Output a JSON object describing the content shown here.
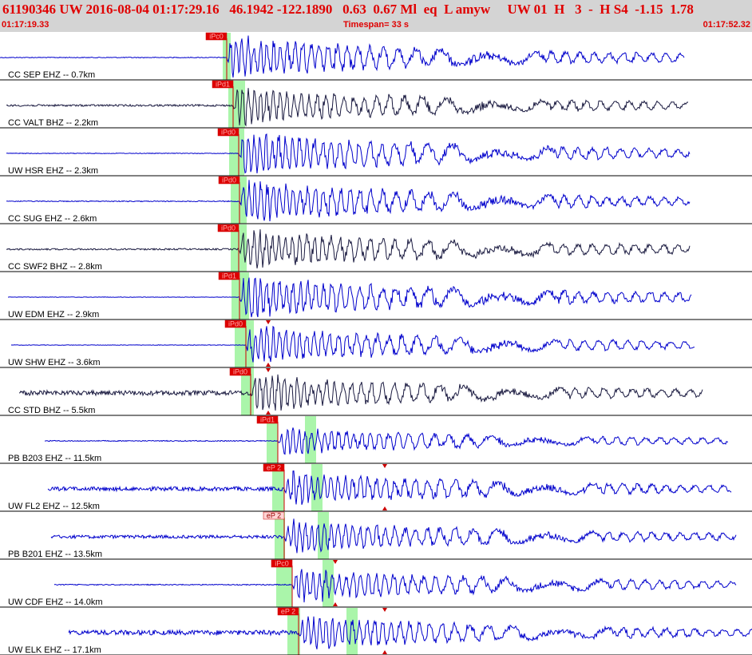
{
  "header": {
    "title": "61190346 UW 2016-08-04 01:17:29.16   46.1942 -122.1890   0.63  0.67 Ml  eq  L amyw     UW 01  H   3  -  H S4  -1.15  1.78",
    "start_time": "01:17:19.33",
    "timespan": "Timespan=  33 s",
    "end_time": "01:17:52.32"
  },
  "colors": {
    "trace_blue": "#0000cc",
    "trace_dark": "#1a1a40",
    "pick_red": "#cc0000",
    "window_green": "#aaf5aa",
    "text_red": "#e00000"
  },
  "traces": [
    {
      "label": "CC SEP EHZ -- 0.7km",
      "pick": "iPc0",
      "pick_style": "red",
      "color": "blue",
      "start": 0,
      "onset": 284,
      "end": 857,
      "amp": 27,
      "noise": 0.5,
      "green": [
        279,
        289
      ]
    },
    {
      "label": "CC VALT BHZ -- 2.2km",
      "pick": "iPd1",
      "pick_style": "red",
      "color": "dark",
      "start": 8,
      "onset": 292,
      "end": 862,
      "amp": 24,
      "noise": 1.2,
      "green": [
        286,
        307
      ]
    },
    {
      "label": "UW HSR EHZ -- 2.3km",
      "pick": "iPd0",
      "pick_style": "red",
      "color": "blue",
      "start": 8,
      "onset": 299,
      "end": 864,
      "amp": 28,
      "noise": 0.4,
      "green": [
        287,
        306
      ]
    },
    {
      "label": "CC SUG EHZ -- 2.6km",
      "pick": "iPd0",
      "pick_style": "red",
      "color": "blue",
      "start": 8,
      "onset": 300,
      "end": 864,
      "amp": 27,
      "noise": 0.6,
      "green": [
        289,
        309
      ]
    },
    {
      "label": "CC SWF2 BHZ -- 2.8km",
      "pick": "iPd0",
      "pick_style": "red",
      "color": "dark",
      "start": 8,
      "onset": 299,
      "end": 864,
      "amp": 26,
      "noise": 1.0,
      "green": [
        289,
        309
      ]
    },
    {
      "label": "UW EDM EHZ -- 2.9km",
      "pick": "iPd1",
      "pick_style": "red",
      "color": "blue",
      "start": 10,
      "onset": 300,
      "end": 866,
      "amp": 28,
      "noise": 0.3,
      "green": [
        290,
        312
      ]
    },
    {
      "label": "UW SHW EHZ -- 3.6km",
      "pick": "iPd0",
      "pick_style": "red",
      "color": "blue",
      "start": 14,
      "onset": 308,
      "end": 870,
      "amp": 24,
      "noise": 0.3,
      "green": [
        294,
        318
      ],
      "s_pick": 336
    },
    {
      "label": "CC STD BHZ -- 5.5km",
      "pick": "iPd0",
      "pick_style": "red",
      "color": "dark",
      "start": 24,
      "onset": 314,
      "end": 880,
      "amp": 24,
      "noise": 3.0,
      "green": [
        302,
        318
      ],
      "s_pick": 336
    },
    {
      "label": "PB B203 EHZ -- 11.5km",
      "pick": "iPd1",
      "pick_style": "red",
      "color": "blue",
      "start": 56,
      "onset": 348,
      "end": 912,
      "amp": 18,
      "noise": 0.6,
      "green": [
        334,
        348
      ],
      "green2": [
        382,
        396
      ]
    },
    {
      "label": "UW FL2 EHZ -- 12.5km",
      "pick": "eP 2",
      "pick_style": "red",
      "color": "blue",
      "start": 60,
      "onset": 356,
      "end": 916,
      "amp": 22,
      "noise": 2.5,
      "green": [
        341,
        356
      ],
      "green2": [
        390,
        404
      ],
      "s_pick": 482
    },
    {
      "label": "PB B201 EHZ -- 13.5km",
      "pick": "eP 2",
      "pick_style": "pale",
      "color": "blue",
      "start": 64,
      "onset": 356,
      "end": 922,
      "amp": 22,
      "noise": 2.0,
      "green": [
        344,
        357
      ],
      "green2": [
        398,
        412
      ]
    },
    {
      "label": "UW CDF EHZ -- 14.0km",
      "pick": "iPc0",
      "pick_style": "red",
      "color": "blue",
      "start": 68,
      "onset": 366,
      "end": 922,
      "amp": 22,
      "noise": 0.6,
      "green": [
        346,
        366
      ],
      "green2": [
        404,
        418
      ],
      "s_pick": 420
    },
    {
      "label": "UW ELK EHZ -- 17.1km",
      "pick": "eP 2",
      "pick_style": "red",
      "color": "blue",
      "start": 86,
      "onset": 374,
      "end": 942,
      "amp": 22,
      "noise": 3.0,
      "green": [
        360,
        376
      ],
      "green2": [
        434,
        448
      ],
      "s_pick": 482
    }
  ]
}
